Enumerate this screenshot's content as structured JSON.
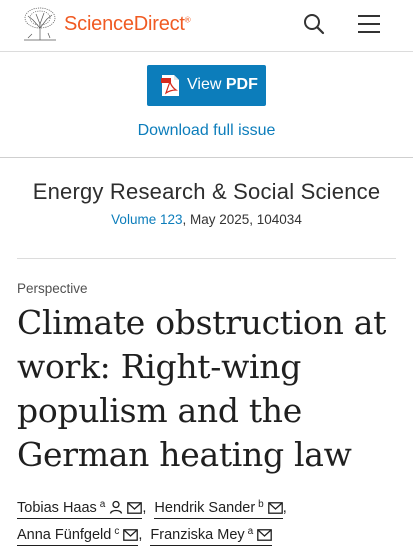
{
  "header": {
    "brand": "ScienceDirect",
    "brand_mark": "®",
    "logo_icon": "elsevier-tree-icon",
    "search_icon": "search-icon",
    "menu_icon": "hamburger-menu-icon",
    "brand_color": "#f05a22"
  },
  "actions": {
    "view_pdf_prefix": "View ",
    "view_pdf_strong": "PDF",
    "download_issue": "Download full issue",
    "accent": "#0c7dbb"
  },
  "journal": {
    "title": "Energy Research & Social Science",
    "volume": "Volume 123",
    "issue_info": ", May 2025, 104034"
  },
  "article": {
    "type": "Perspective",
    "title": "Climate obstruction at work: Right-wing populism and the German heating law"
  },
  "authors": [
    {
      "name": "Tobias Haas",
      "affil": "a",
      "person_icon": true,
      "mail_icon": true
    },
    {
      "name": "Hendrik Sander",
      "affil": "b",
      "person_icon": false,
      "mail_icon": true
    },
    {
      "name": "Anna Fünfgeld",
      "affil": "c",
      "person_icon": false,
      "mail_icon": true
    },
    {
      "name": "Franziska Mey",
      "affil": "a",
      "person_icon": false,
      "mail_icon": true
    }
  ]
}
